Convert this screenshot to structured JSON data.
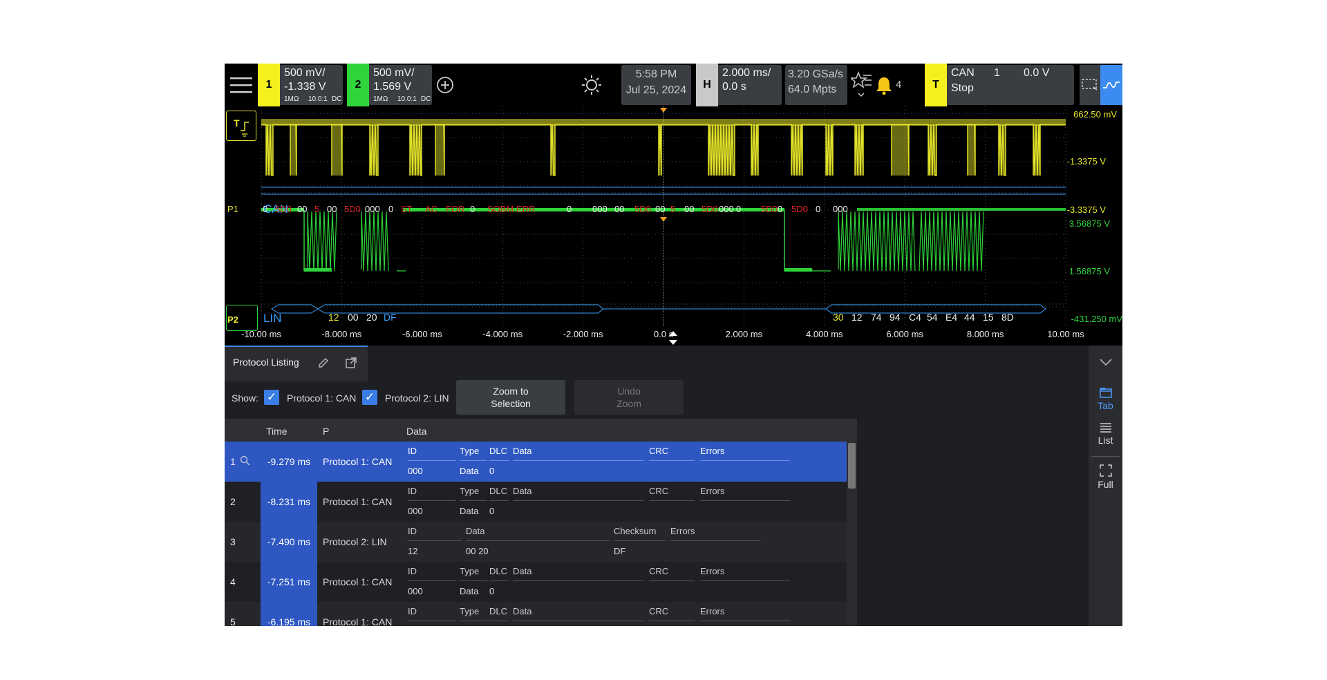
{
  "topbar": {
    "ch1": {
      "num": "1",
      "scale": "500 mV/",
      "offset": "-1.338 V",
      "imp": "1MΩ",
      "probe": "10.0:1",
      "coupling": "DC"
    },
    "ch2": {
      "num": "2",
      "scale": "500 mV/",
      "offset": "1.569 V",
      "imp": "1MΩ",
      "probe": "10.0:1",
      "coupling": "DC"
    },
    "time": "5:58 PM",
    "date": "Jul 25, 2024",
    "horiz": {
      "label": "H",
      "scale": "2.000 ms/",
      "delay": "0.0 s"
    },
    "acq": {
      "rate": "3.20 GSa/s",
      "depth": "64.0 Mpts"
    },
    "alerts": "4",
    "trigger": {
      "label": "T",
      "type": "CAN",
      "channel": "1",
      "level": "0.0 V",
      "state": "Stop"
    }
  },
  "waveform": {
    "ch1_scale": {
      "top": "662.50 mV",
      "mid": "-1.3375 V",
      "bot": "-3.3375 V"
    },
    "ch2_scale": {
      "top": "3.56875 V",
      "mid": "1.56875 V",
      "bot": "-431.250 mV"
    },
    "p1": {
      "label": "P1",
      "proto": "CAN"
    },
    "p2": {
      "label": "P2",
      "proto": "LIN"
    },
    "can_decode": [
      "0",
      "5D0",
      "00",
      "5",
      "00",
      "5D0",
      "000",
      "0",
      "ST",
      "AC",
      "FOR",
      "0",
      "SOBM ERR",
      "0",
      "000",
      "00",
      "5D0",
      "00",
      "5",
      "00",
      "5D0",
      "000",
      "0",
      "5D0",
      "0",
      "5D0",
      "0",
      "000"
    ],
    "lin_decode_1": [
      "12",
      "00",
      "20",
      "DF"
    ],
    "lin_decode_2": [
      "30",
      "12",
      "74",
      "94",
      "C4",
      "54",
      "E4",
      "44",
      "15",
      "8D"
    ],
    "time_labels": [
      "-10.00 ms",
      "-8.000 ms",
      "-6.000 ms",
      "-4.000 ms",
      "-2.000 ms",
      "0.0 s",
      "2.000 ms",
      "4.000 ms",
      "6.000 ms",
      "8.000 ms",
      "10.00 ms"
    ],
    "colors": {
      "ch1": "#e8e82a",
      "ch2": "#2ed33a",
      "can": "#3aa0ff",
      "err": "#e02424"
    }
  },
  "listing": {
    "tab_title": "Protocol Listing",
    "show_label": "Show:",
    "protocol1": "Protocol 1: CAN",
    "protocol2": "Protocol 2: LIN",
    "zoom_btn": "Zoom to Selection",
    "undo_btn": "Undo Zoom",
    "columns": {
      "time": "Time",
      "p": "P",
      "data": "Data"
    },
    "rows": [
      {
        "idx": "1",
        "time": "-9.279 ms",
        "p": "Protocol 1: CAN",
        "headers": [
          "ID",
          "Type",
          "DLC",
          "Data",
          "CRC",
          "Errors"
        ],
        "values": [
          "000",
          "Data",
          "0",
          "",
          "",
          ""
        ],
        "selected": true
      },
      {
        "idx": "2",
        "time": "-8.231 ms",
        "p": "Protocol 1: CAN",
        "headers": [
          "ID",
          "Type",
          "DLC",
          "Data",
          "CRC",
          "Errors"
        ],
        "values": [
          "000",
          "Data",
          "0",
          "",
          "",
          ""
        ],
        "selected": false
      },
      {
        "idx": "3",
        "time": "-7.490 ms",
        "p": "Protocol 2: LIN",
        "headers": [
          "ID",
          "Data",
          "Checksum",
          "Errors"
        ],
        "values": [
          "12",
          "00 20",
          "DF",
          ""
        ],
        "selected": false
      },
      {
        "idx": "4",
        "time": "-7.251 ms",
        "p": "Protocol 1: CAN",
        "headers": [
          "ID",
          "Type",
          "DLC",
          "Data",
          "CRC",
          "Errors"
        ],
        "values": [
          "000",
          "Data",
          "0",
          "",
          "",
          ""
        ],
        "selected": false
      },
      {
        "idx": "5",
        "time": "-6.195 ms",
        "p": "Protocol 1: CAN",
        "headers": [
          "ID",
          "Type",
          "DLC",
          "Data",
          "CRC",
          "Errors"
        ],
        "values": [
          "",
          "",
          "",
          "",
          "",
          ""
        ],
        "selected": false
      }
    ]
  },
  "sidepanel": {
    "tab": "Tab",
    "list": "List",
    "full": "Full"
  }
}
